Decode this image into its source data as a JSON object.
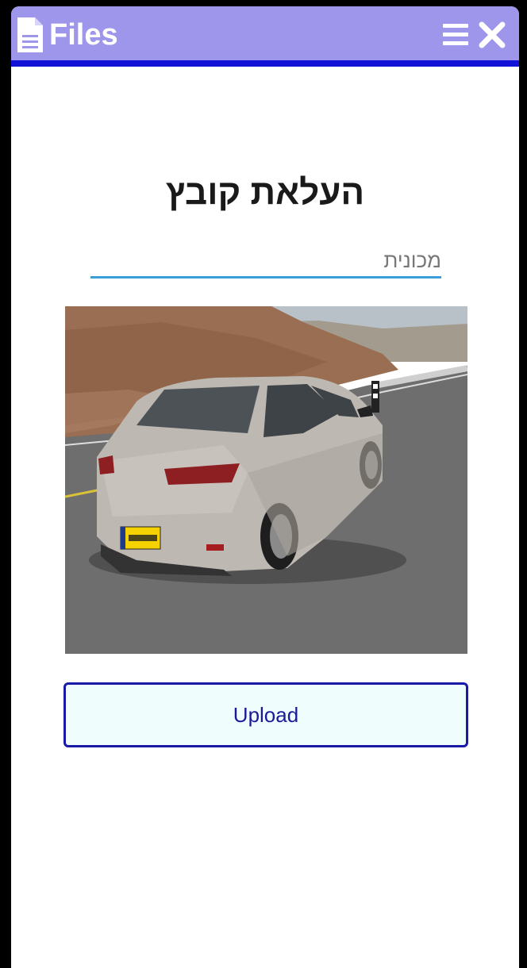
{
  "header": {
    "title": "Files",
    "file_icon": "document-icon",
    "menu_icon": "hamburger-menu-icon",
    "close_icon": "close-icon",
    "background_color": "#9d96ea",
    "accent_color": "#1212d6"
  },
  "main": {
    "title": "העלאת קובץ",
    "car_input": {
      "value": "",
      "placeholder": "מכונית"
    },
    "photo_subject": "silver sedan parked on mountain road",
    "upload_button_label": "Upload"
  }
}
